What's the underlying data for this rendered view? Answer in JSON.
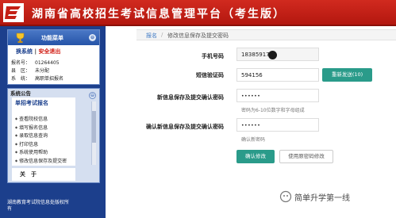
{
  "header": {
    "title": "湖南省高校招生考试信息管理平台（考生版）",
    "brand_color": "#c41f15"
  },
  "sidebar": {
    "function_menu_title": "功能菜单",
    "collapse_icon": "⊖",
    "user_links": {
      "exam_system": "换系统",
      "separator": "|",
      "logout": "安全退出"
    },
    "info": [
      {
        "key": "报名号：",
        "value": "01264405"
      },
      {
        "key": "县　区：",
        "value": "未分配"
      },
      {
        "key": "系　统：",
        "value": "高职单招报名"
      }
    ],
    "system_label": "系统公告",
    "menu": {
      "title": "单招考试报名",
      "items": [
        "查看院校信息",
        "填写报名信息",
        "录取信息查询",
        "打印信息",
        "系统使用帮助",
        "修改信息保存及提交密"
      ]
    },
    "about_label": "关　于",
    "footer": "湖南教育考试院信息处版权所有"
  },
  "breadcrumb": {
    "home": "报名",
    "separator": "/",
    "current": "修改信息保存及提交密码"
  },
  "form": {
    "phone_label": "手机号码",
    "phone_value": "18385917",
    "code_label": "短信验证码",
    "code_value": "594156",
    "resend_button": "重新发送(10)",
    "new_password_label": "新信息保存及提交确认密码",
    "new_password_value": "••••••",
    "new_password_hint": "密码为6-10位数字和字母组成",
    "confirm_label": "确认新信息保存及提交确认密码",
    "confirm_value": "••••••",
    "confirm_hint": "确认新密码",
    "confirm_button": "确认修改",
    "use_original_button": "使用原密码修改"
  },
  "watermark": "简单升学第一线",
  "colors": {
    "accent_green": "#2a9b8a",
    "sidebar_blue": "#1c3f8c"
  }
}
